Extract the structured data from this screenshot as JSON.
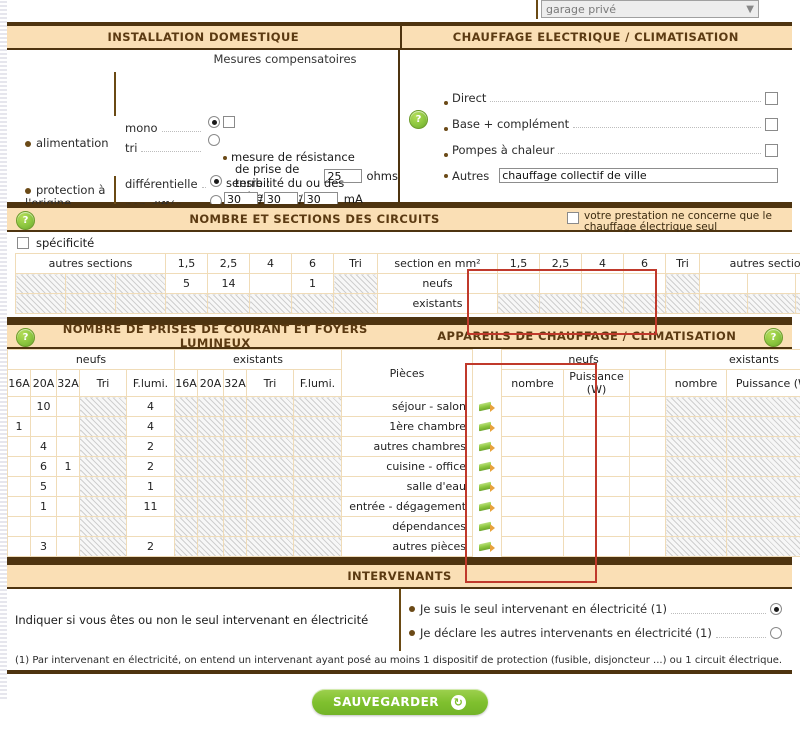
{
  "top": {
    "select_value": "garage privé",
    "select_icon": "chevron-down-icon"
  },
  "installation": {
    "title": "INSTALLATION DOMESTIQUE",
    "mesures_label": "Mesures compensatoires",
    "alimentation_label": "alimentation",
    "mono_label": "mono",
    "tri_label": "tri",
    "mesure_line1": "mesure de résistance",
    "mesure_line2": "de prise de terre :",
    "resistance_value": "25",
    "ohms_label": "ohms",
    "protection_label_1": "protection à",
    "protection_label_2": "l'origine",
    "differentielle_label": "différentielle",
    "non_differ_label": "non différ.",
    "sensibilite_label": "sensibilité du ou des différentiels :",
    "sens1": "30",
    "sens2": "30",
    "sens3": "30",
    "ma_label": "mA",
    "sep1": "/",
    "sep2": "/"
  },
  "chauffage": {
    "title": "CHAUFFAGE ELECTRIQUE / CLIMATISATION",
    "help_icon": "help-icon",
    "items": [
      {
        "label": "Direct",
        "checked": false
      },
      {
        "label": "Base + complément",
        "checked": false
      },
      {
        "label": "Pompes à chaleur",
        "checked": false
      }
    ],
    "autres_label": "Autres",
    "autres_value": "chauffage collectif de ville"
  },
  "circuits": {
    "title": "NOMBRE ET SECTIONS DES CIRCUITS",
    "help_icon": "help-icon",
    "checkbox_note_line1": "votre prestation ne concerne que le",
    "checkbox_note_line2": "chauffage électrique seul",
    "specificite_label": "spécificité",
    "left_headers": [
      "autres sections",
      "1,5",
      "2,5",
      "4",
      "6",
      "Tri"
    ],
    "center_header": "section en mm²",
    "right_headers": [
      "1,5",
      "2,5",
      "4",
      "6",
      "Tri",
      "autres sections"
    ],
    "rows": [
      {
        "label": "neufs",
        "left": {
          "autres": [
            "",
            "",
            ""
          ],
          "s15": "5",
          "s25": "14",
          "s4": "",
          "s6": "1",
          "tri": ""
        },
        "right": {
          "s15": "",
          "s25": "",
          "s4": "",
          "s6": "",
          "tri": "",
          "autres": [
            "",
            "",
            ""
          ]
        }
      },
      {
        "label": "existants",
        "left": {
          "autres": [
            "",
            "",
            ""
          ],
          "s15": "",
          "s25": "",
          "s4": "",
          "s6": "",
          "tri": ""
        },
        "right": {
          "s15": "",
          "s25": "",
          "s4": "",
          "s6": "",
          "tri": "",
          "autres": [
            "",
            "",
            ""
          ]
        }
      }
    ]
  },
  "prises": {
    "title": "NOMBRE DE PRISES DE COURANT ET FOYERS LUMINEUX",
    "help_icon": "help-icon",
    "group_neufs": "neufs",
    "group_existants": "existants",
    "sub_headers": [
      "16A",
      "20A",
      "32A",
      "Tri",
      "F.lumi."
    ],
    "pieces_header": "Pièces",
    "rows": [
      {
        "piece": "séjour - salon",
        "neufs": {
          "a16": "",
          "a20": "10",
          "a32": "",
          "tri": "",
          "flumi": "4"
        },
        "existants": {
          "a16": "",
          "a20": "",
          "a32": "",
          "tri": "",
          "flumi": ""
        }
      },
      {
        "piece": "1ère chambre",
        "neufs": {
          "a16": "1",
          "a20": "",
          "a32": "",
          "tri": "",
          "flumi": "4"
        },
        "existants": {
          "a16": "",
          "a20": "",
          "a32": "",
          "tri": "",
          "flumi": ""
        }
      },
      {
        "piece": "autres chambres",
        "neufs": {
          "a16": "",
          "a20": "4",
          "a32": "",
          "tri": "",
          "flumi": "2"
        },
        "existants": {
          "a16": "",
          "a20": "",
          "a32": "",
          "tri": "",
          "flumi": ""
        }
      },
      {
        "piece": "cuisine - office",
        "neufs": {
          "a16": "",
          "a20": "6",
          "a32": "1",
          "tri": "",
          "flumi": "2"
        },
        "existants": {
          "a16": "",
          "a20": "",
          "a32": "",
          "tri": "",
          "flumi": ""
        }
      },
      {
        "piece": "salle d'eau",
        "neufs": {
          "a16": "",
          "a20": "5",
          "a32": "",
          "tri": "",
          "flumi": "1"
        },
        "existants": {
          "a16": "",
          "a20": "",
          "a32": "",
          "tri": "",
          "flumi": ""
        }
      },
      {
        "piece": "entrée - dégagement",
        "neufs": {
          "a16": "",
          "a20": "1",
          "a32": "",
          "tri": "",
          "flumi": "11"
        },
        "existants": {
          "a16": "",
          "a20": "",
          "a32": "",
          "tri": "",
          "flumi": ""
        }
      },
      {
        "piece": "dépendances",
        "neufs": {
          "a16": "",
          "a20": "",
          "a32": "",
          "tri": "",
          "flumi": ""
        },
        "existants": {
          "a16": "",
          "a20": "",
          "a32": "",
          "tri": "",
          "flumi": ""
        }
      },
      {
        "piece": "autres pièces",
        "neufs": {
          "a16": "",
          "a20": "3",
          "a32": "",
          "tri": "",
          "flumi": "2"
        },
        "existants": {
          "a16": "",
          "a20": "",
          "a32": "",
          "tri": "",
          "flumi": ""
        }
      }
    ]
  },
  "appareils": {
    "title": "APPAREILS DE CHAUFFAGE / CLIMATISATION",
    "help_icon": "help-icon",
    "group_neufs": "neufs",
    "group_existants": "existants",
    "col_nombre": "nombre",
    "col_puissance": "Puissance (W)",
    "rows": [
      {
        "neufs": {
          "nombre": "",
          "puissance": "",
          "extra": ""
        },
        "existants": {
          "nombre": "",
          "puissance": "",
          "extra": ""
        }
      },
      {
        "neufs": {
          "nombre": "",
          "puissance": "",
          "extra": ""
        },
        "existants": {
          "nombre": "",
          "puissance": "",
          "extra": ""
        }
      },
      {
        "neufs": {
          "nombre": "",
          "puissance": "",
          "extra": ""
        },
        "existants": {
          "nombre": "",
          "puissance": "",
          "extra": ""
        }
      },
      {
        "neufs": {
          "nombre": "",
          "puissance": "",
          "extra": ""
        },
        "existants": {
          "nombre": "",
          "puissance": "",
          "extra": ""
        }
      },
      {
        "neufs": {
          "nombre": "",
          "puissance": "",
          "extra": ""
        },
        "existants": {
          "nombre": "",
          "puissance": "",
          "extra": ""
        }
      },
      {
        "neufs": {
          "nombre": "",
          "puissance": "",
          "extra": ""
        },
        "existants": {
          "nombre": "",
          "puissance": "",
          "extra": ""
        }
      },
      {
        "neufs": {
          "nombre": "",
          "puissance": "",
          "extra": ""
        },
        "existants": {
          "nombre": "",
          "puissance": "",
          "extra": ""
        }
      },
      {
        "neufs": {
          "nombre": "",
          "puissance": "",
          "extra": ""
        },
        "existants": {
          "nombre": "",
          "puissance": "",
          "extra": ""
        }
      }
    ]
  },
  "intervenants": {
    "title": "INTERVENANTS",
    "question": "Indiquer si vous êtes ou non le seul intervenant en électricité",
    "option1": "Je suis le seul intervenant en électricité (1)",
    "option2": "Je déclare les autres intervenants en électricité (1)",
    "selected": 0,
    "footnote": "(1) Par intervenant en électricité, on entend un intervenant ayant posé au moins 1 dispositif de protection (fusible, disjoncteur ...) ou 1 circuit électrique."
  },
  "save": {
    "label": "SAUVEGARDER",
    "icon": "refresh-icon"
  },
  "colors": {
    "band_bg": "#fadfb5",
    "band_border": "#4e3410",
    "band_text": "#5b3a12",
    "grid_line": "#f0dcb8",
    "highlight": "#c0392b",
    "green": "#8cc63f"
  }
}
